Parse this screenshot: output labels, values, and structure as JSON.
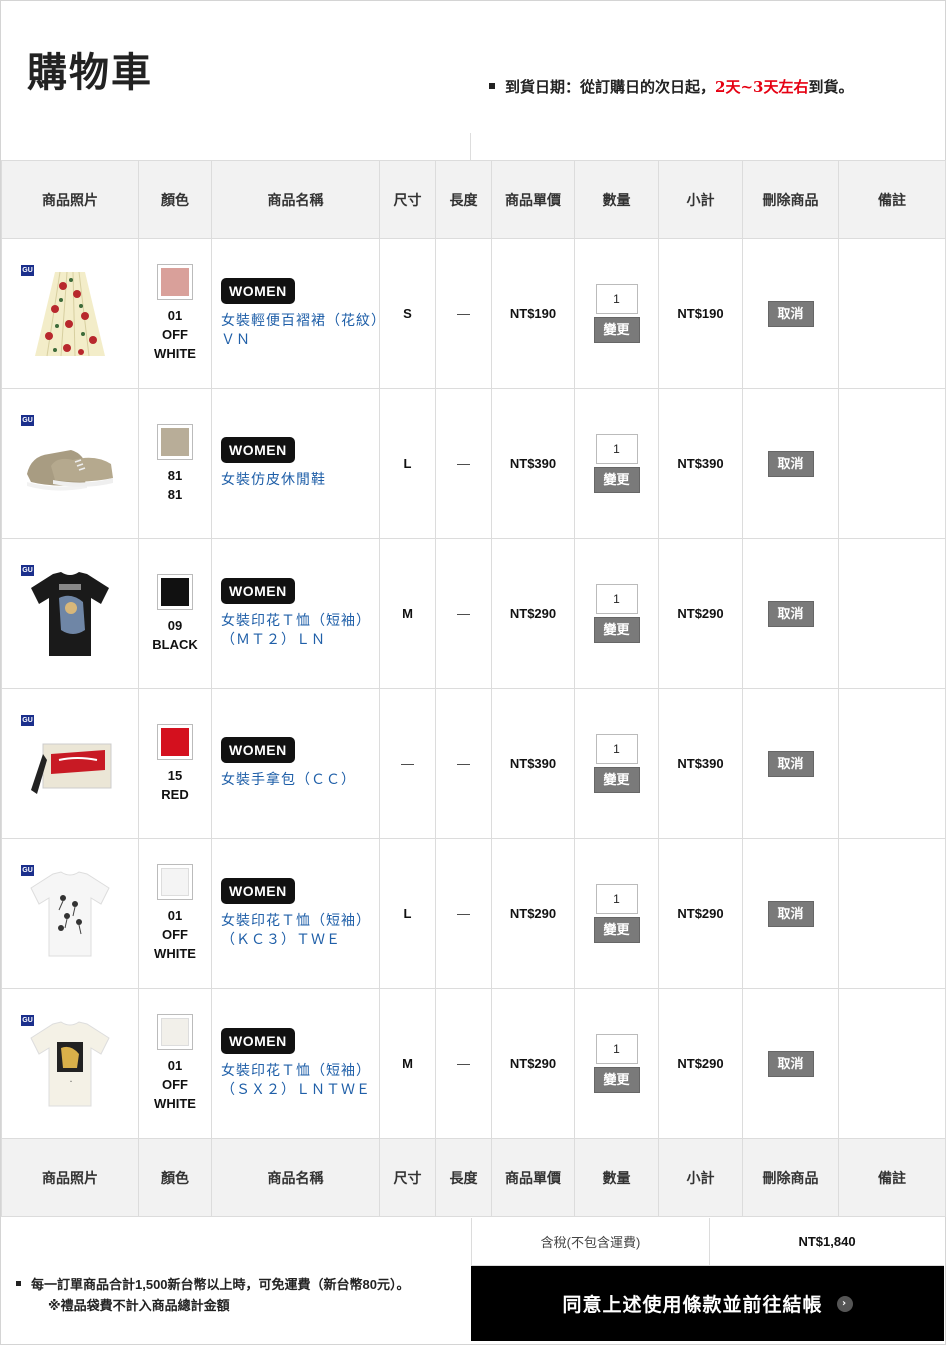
{
  "page_title": "購物車",
  "delivery_notice": {
    "prefix": "到貨日期：從訂購日的次日起，",
    "highlight": "2天~3天左右",
    "suffix": "到貨。"
  },
  "columns": [
    "商品照片",
    "顏色",
    "商品名稱",
    "尺寸",
    "長度",
    "商品單價",
    "數量",
    "小計",
    "刪除商品",
    "備註"
  ],
  "badge_label": "WOMEN",
  "change_label": "變更",
  "cancel_label": "取消",
  "brand_mark": "GU",
  "items": [
    {
      "photo": "floral-skirt",
      "swatch": "#d9a09a",
      "color_code": "01",
      "color_name": "OFF WHITE",
      "name": "女裝輕便百褶裙（花紋）ＶＮ",
      "size": "S",
      "length": "—",
      "price": "NT$190",
      "qty": "1",
      "subtotal": "NT$190",
      "note": ""
    },
    {
      "photo": "sneakers",
      "swatch": "#b8ad98",
      "color_code": "81",
      "color_name": "81",
      "name": "女裝仿皮休閒鞋",
      "size": "L",
      "length": "—",
      "price": "NT$390",
      "qty": "1",
      "subtotal": "NT$390",
      "note": ""
    },
    {
      "photo": "black-tee",
      "swatch": "#111111",
      "color_code": "09",
      "color_name": "BLACK",
      "name": "女裝印花Ｔ恤（短袖）（ＭＴ２）ＬＮ",
      "size": "M",
      "length": "—",
      "price": "NT$290",
      "qty": "1",
      "subtotal": "NT$290",
      "note": ""
    },
    {
      "photo": "red-pouch",
      "swatch": "#d4101e",
      "color_code": "15",
      "color_name": "RED",
      "name": "女裝手拿包（ＣＣ）",
      "size": "—",
      "length": "—",
      "price": "NT$390",
      "qty": "1",
      "subtotal": "NT$390",
      "note": ""
    },
    {
      "photo": "white-tee-1",
      "swatch": "#f4f4f4",
      "color_code": "01",
      "color_name": "OFF WHITE",
      "name": "女裝印花Ｔ恤（短袖）（ＫＣ３）ＴＷＥ",
      "size": "L",
      "length": "—",
      "price": "NT$290",
      "qty": "1",
      "subtotal": "NT$290",
      "note": ""
    },
    {
      "photo": "white-tee-2",
      "swatch": "#f2f0ea",
      "color_code": "01",
      "color_name": "OFF WHITE",
      "name": "女裝印花Ｔ恤（短袖）（ＳＸ２）ＬＮＴＷＥ",
      "size": "M",
      "length": "—",
      "price": "NT$290",
      "qty": "1",
      "subtotal": "NT$290",
      "note": ""
    }
  ],
  "tax_label": "含稅(不包含運費)",
  "total": "NT$1,840",
  "checkout_label": "同意上述使用條款並前往結帳",
  "footnote_main": "每一訂單商品合計1,500新台幣以上時，可免運費（新台幣80元）。",
  "footnote_sub": "※禮品袋費不計入商品總計金額"
}
